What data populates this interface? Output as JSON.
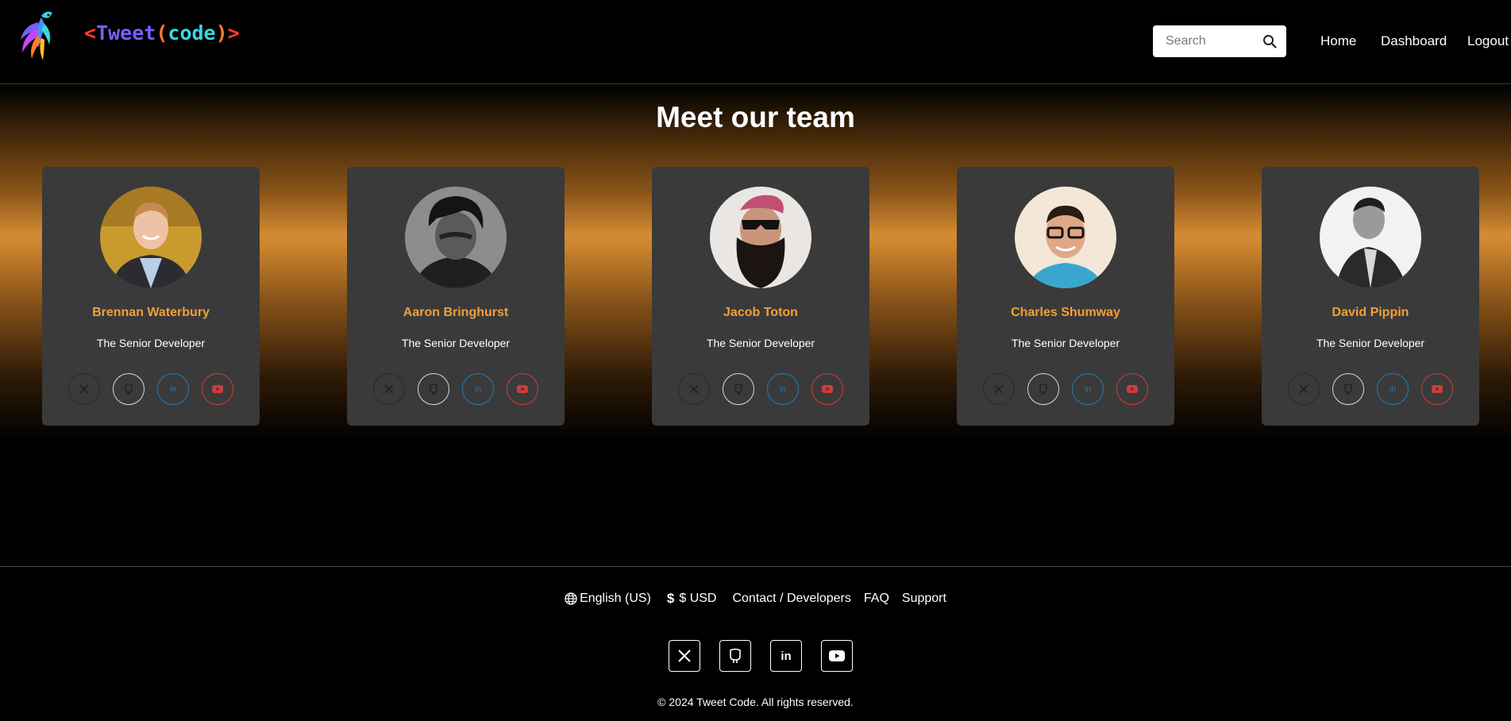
{
  "brand": {
    "open": "<",
    "word1": "Tweet",
    "paren_open": "(",
    "word2": "code",
    "paren_close": ")",
    "close": ">"
  },
  "header": {
    "search_placeholder": "Search",
    "nav": [
      "Home",
      "Dashboard",
      "Logout"
    ]
  },
  "team": {
    "title": "Meet our team",
    "members": [
      {
        "name": "Brennan Waterbury",
        "role": "The Senior Developer"
      },
      {
        "name": "Aaron Bringhurst",
        "role": "The Senior Developer"
      },
      {
        "name": "Jacob Toton",
        "role": "The Senior Developer"
      },
      {
        "name": "Charles Shumway",
        "role": "The Senior Developer"
      },
      {
        "name": "David Pippin",
        "role": "The Senior Developer"
      }
    ],
    "social_icons": [
      "x-icon",
      "github-icon",
      "linkedin-icon",
      "youtube-icon"
    ]
  },
  "footer": {
    "language": "English (US)",
    "currency": "$ USD",
    "links": [
      "Contact / Developers",
      "FAQ",
      "Support"
    ],
    "social_icons": [
      "x-icon",
      "github-icon",
      "linkedin-icon",
      "youtube-icon"
    ],
    "copyright": "© 2024 Tweet Code. All rights reserved."
  },
  "colors": {
    "accent_name": "#f0a03a",
    "card_bg": "#3a3a3a",
    "linkedin": "#1a7fc1",
    "youtube": "#d33a3a"
  }
}
